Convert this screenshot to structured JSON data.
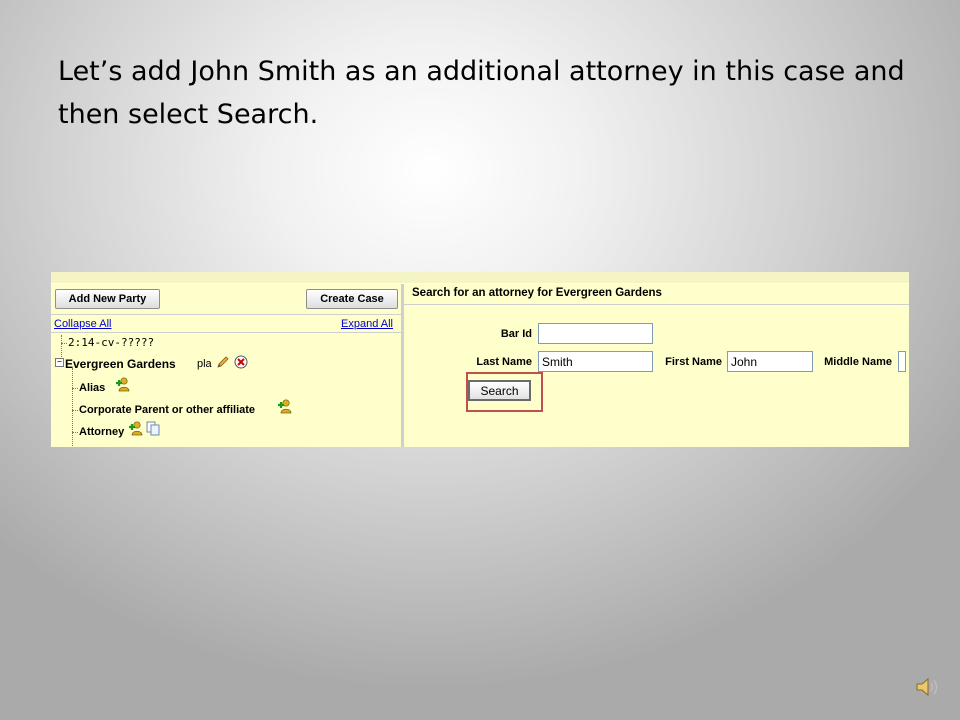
{
  "slide": {
    "title": "Let’s add John Smith as an additional attorney in this case and then select Search."
  },
  "left_pane": {
    "add_party_label": "Add New Party",
    "create_case_label": "Create Case",
    "collapse_all": "Collapse All",
    "expand_all": "Expand All",
    "case_number": "2:14-cv-?????",
    "party_name": "Evergreen Gardens",
    "party_role": "pla",
    "children": [
      {
        "label": "Alias",
        "icon": "add-person-icon"
      },
      {
        "label": "Corporate Parent or other affiliate",
        "icon": "add-person-icon"
      },
      {
        "label": "Attorney",
        "icon": "add-person-icon"
      }
    ]
  },
  "search_panel": {
    "heading": "Search for an attorney for Evergreen Gardens",
    "bar_id_label": "Bar Id",
    "bar_id_value": "",
    "last_name_label": "Last Name",
    "last_name_value": "Smith",
    "first_name_label": "First Name",
    "first_name_value": "John",
    "middle_name_label": "Middle Name",
    "middle_name_value": "",
    "search_label": "Search"
  },
  "colors": {
    "panel_background": "#ffffcc",
    "highlight_border": "#c0504d",
    "link": "#0000cc"
  }
}
